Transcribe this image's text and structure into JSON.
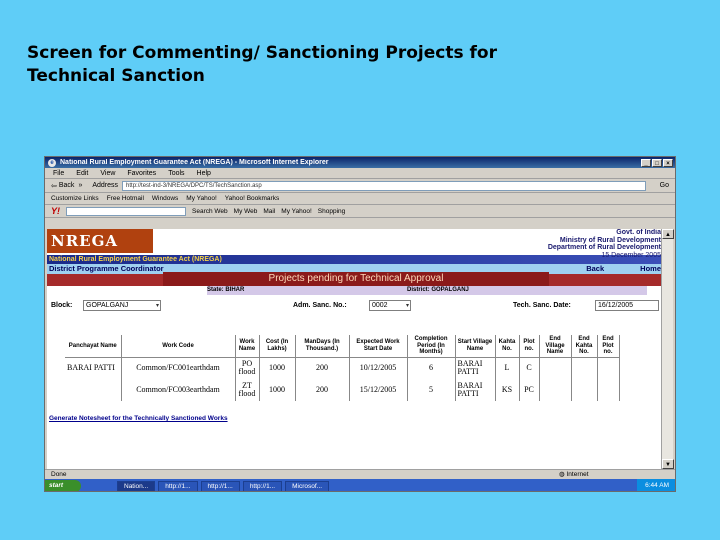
{
  "slide": {
    "title_line1": "Screen for Commenting/ Sanctioning Projects for",
    "title_line2": "Technical Sanction"
  },
  "browser": {
    "window_title": "National Rural Employment Guarantee Act (NREGA) - Microsoft Internet Explorer",
    "menu": [
      "File",
      "Edit",
      "View",
      "Favorites",
      "Tools",
      "Help"
    ],
    "back_label": "Back",
    "address_label": "Address",
    "address_value": "http://test-ind-3/NREGA/DPC/TS/TechSanction.asp",
    "go_label": "Go",
    "links": [
      "Customize Links",
      "Free Hotmail",
      "Windows",
      "My Yahoo!",
      "Yahoo! Bookmarks"
    ],
    "yahoo_logo": "Y!",
    "yahoo_items": [
      "Search Web",
      "My Web",
      "Mail",
      "My Yahoo!",
      "Shopping"
    ],
    "status_text": "Done",
    "zone_text": "Internet"
  },
  "taskbar": {
    "start": "start",
    "tasks": [
      "Nation...",
      "http://1...",
      "http://1...",
      "http://1...",
      "Microsof..."
    ],
    "clock": "6:44 AM"
  },
  "page": {
    "logo": "NREGA",
    "gov1": "Govt. of India",
    "gov2": "Ministry of Rural Development",
    "gov3": "Department of Rural Development",
    "date": "15 December 2005",
    "act_line": "National Rural Employment Guarantee Act (NREGA)",
    "role": "District Programme Coordinator",
    "back_link": "Back",
    "home_link": "Home",
    "pending_title": "Projects pending for Technical Approval",
    "state_label": "State: BIHAR",
    "district_label": "District: GOPALGANJ",
    "block_label": "Block:",
    "block_value": "GOPALGANJ",
    "adm_label": "Adm. Sanc. No.:",
    "adm_value": "0002",
    "tech_label": "Tech. Sanc. Date:",
    "tech_value": "16/12/2005",
    "footer_link": "Generate Notesheet for the Technically Sanctioned Works"
  },
  "table": {
    "headers": [
      "Panchayat Name",
      "Work Code",
      "Work Name",
      "Cost (In Lakhs)",
      "ManDays (In Thousand.)",
      "Expected Work Start Date",
      "Completion Period (In Months)",
      "Start Village Name",
      "Kahta No.",
      "Plot no.",
      "End Village Name",
      "End Kahta No.",
      "End Plot no."
    ],
    "rows": [
      [
        "BARAI PATTI",
        "Common/FC001earthdam",
        "PO flood",
        "1000",
        "200",
        "10/12/2005",
        "6",
        "BARAI PATTI",
        "L",
        "C",
        "",
        "",
        ""
      ],
      [
        "",
        "Common/FC003earthdam",
        "ZT flood",
        "1000",
        "200",
        "15/12/2005",
        "5",
        "BARAI PATTI",
        "KS",
        "PC",
        "",
        "",
        ""
      ]
    ]
  }
}
